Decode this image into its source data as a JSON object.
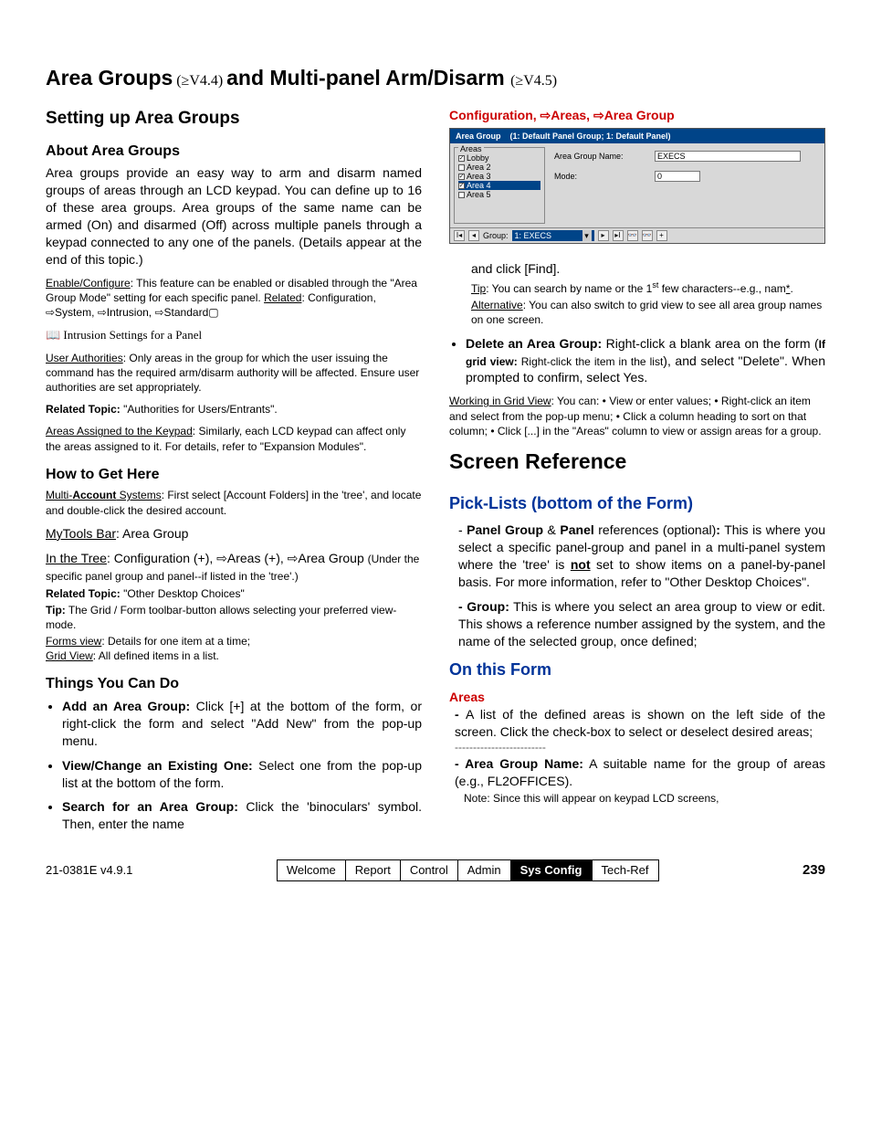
{
  "title": {
    "part1": "Area Groups",
    "ver1": "(≥V4.4)",
    "part2": " and Multi-panel Arm/Disarm ",
    "ver2": "(≥V4.5)"
  },
  "left": {
    "h_setting": "Setting up Area Groups",
    "h_about": "About Area Groups",
    "p_about_main": "Area groups provide an easy way to arm and disarm named groups of areas through an LCD keypad.  You can define up to 16 of these area groups.  Area groups of the same name can be armed (On) and disarmed (Off) across multiple panels through a keypad connected to any one of the panels.  (Details appear at the end of this topic.)",
    "enable_label": "Enable/Configure",
    "enable_text": ":  This feature can be enabled or disabled through the \"Area Group Mode\" setting for each specific panel.  ",
    "related_u": "Related",
    "enable_path": ":  Configuration, ⇨System, ⇨Intrusion, ⇨Standard▢",
    "intrusion_link": "📖  Intrusion Settings for a Panel",
    "ua_label": "User Authorities",
    "ua_text": ":  Only areas in the group for which the user issuing the command has the required arm/disarm authority will be affected.  Ensure user authorities are set appropriately.",
    "rt_label": "Related Topic:",
    "rt_text": "  \"Authorities for Users/Entrants\".",
    "ak_label": "Areas Assigned to the Keypad",
    "ak_text": ":  Similarly, each LCD keypad can affect only the areas assigned to it.  For details, refer to \"Expansion Modules\".",
    "h_how": "How to Get Here",
    "multi_label_pre": "Multi-",
    "multi_label_b": "Account",
    "multi_label_post": " Systems",
    "multi_text": ":  First select [Account Folders] in the 'tree', and locate and double-click the desired account.",
    "mytools_u": "MyTools Bar",
    "mytools_text": ":  Area Group",
    "intree_u": "In the Tree",
    "intree_text": ":  Configuration (+), ⇨Areas (+), ⇨Area Group  ",
    "intree_paren": "(Under the specific panel group and panel--if listed in the 'tree'.)",
    "rt2_label": "Related Topic:",
    "rt2_text": "  \"Other Desktop Choices\"",
    "tip_label": "Tip:",
    "tip_text": "  The Grid / Form toolbar-button allows selecting your preferred view-mode.",
    "forms_u": "Forms view",
    "forms_text": ":  Details for one item at a time;",
    "grid_u": "Grid View",
    "grid_text": ":  All defined items in a list.",
    "h_things": "Things You Can Do",
    "add_b": "Add an Area Group:",
    "add_t": "  Click [+] at the bottom of the form, or right-click the form and select \"Add New\" from the pop-up menu.",
    "view_b": "View/Change an Existing One:",
    "view_t": "  Select one from the pop-up list at the bottom of the form.",
    "search_b": "Search for an Area Group:",
    "search_t": "  Click the 'binoculars' symbol.  Then, enter the name"
  },
  "right": {
    "configpath": "Configuration, ⇨Areas, ⇨Area Group",
    "ss": {
      "titlebar_a": "Area Group",
      "titlebar_b": "(1: Default Panel Group; 1: Default Panel)",
      "areas_label": "Areas",
      "a1": "Lobby",
      "a2": "Area 2",
      "a3": "Area 3",
      "a4": "Area 4",
      "a5": "Area 5",
      "f1_label": "Area Group Name:",
      "f1_val": "EXECS",
      "f2_label": "Mode:",
      "f2_val": "0",
      "nav_label": "Group:",
      "nav_val": "1: EXECS"
    },
    "cont1": "and click [Find].",
    "tip_u": "Tip",
    "tip_text_a": ":  You can search by name or the 1",
    "tip_sup": "st",
    "tip_text_b": " few characters--e.g., nam",
    "tip_star": "*",
    "tip_text_c": ".",
    "alt_u": "Alternative",
    "alt_text": ":  You can also switch to grid view to see all area group names on one screen.",
    "del_b": "Delete an Area Group:",
    "del_t1": "  Right-click a blank area on the form (",
    "del_if": "If grid view:",
    "del_t2": " Right-click the item in the list",
    "del_t3": "), and select \"Delete\".  When prompted to confirm, select Yes.",
    "wgv_u": "Working in Grid View",
    "wgv_text": ":  You can:  • View or enter values;  • Right-click an item and select from the pop-up menu;  • Click a column heading to sort on that column;  • Click [...] in the \"Areas\" column to view or assign areas for a group.",
    "h_screen": "Screen Reference",
    "h_pick": "Pick-Lists (bottom of the Form)",
    "pick1_pre": "- ",
    "pick1_b1": "Panel Group",
    "pick1_amp": " & ",
    "pick1_b2": "Panel",
    "pick1_post": " references (optional)",
    "pick1_colon": ":",
    "pick1_text": "This is where you select a specific panel-group and panel in a multi-panel system where the 'tree' is ",
    "pick1_not": "not",
    "pick1_text2": " set to show items on a panel-by-panel basis.  For more information, refer to \"Other Desktop Choices\".",
    "pick2_b": "- Group:",
    "pick2_t": " This is where you select an area group to view or edit.  This shows a reference number assigned by the system, and the name of the selected group, once defined;",
    "h_onform": "On this Form",
    "h_areas": "Areas",
    "areas_dash": "- ",
    "areas_t": "A list of the defined areas is shown on the left side of the screen.  Click the check-box to select or deselect desired areas;",
    "dashline": "-------------------------",
    "agn_b": "- Area Group Name:",
    "agn_t": " A suitable name for the group of areas (e.g., FL2OFFICES).",
    "agn_note": "Note:  Since this will appear on keypad LCD screens,"
  },
  "footer": {
    "doc": "21-0381E v4.9.1",
    "tabs": [
      "Welcome",
      "Report",
      "Control",
      "Admin",
      "Sys Config",
      "Tech-Ref"
    ],
    "active": 4,
    "page": "239"
  }
}
